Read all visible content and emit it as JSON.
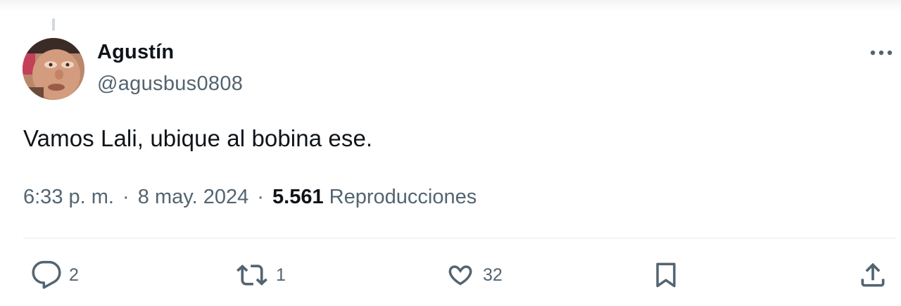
{
  "tweet": {
    "author": {
      "display_name": "Agustín",
      "handle": "@agusbus0808"
    },
    "text": "Vamos Lali, ubique al bobina ese.",
    "time": "6:33 p. m.",
    "date": "8 may. 2024",
    "separator": "·",
    "views_count": "5.561",
    "views_label": "Reproducciones"
  },
  "actions": {
    "reply_count": "2",
    "retweet_count": "1",
    "like_count": "32"
  },
  "icons": {
    "more": "more-horizontal-icon",
    "reply": "comment-bubble-icon",
    "retweet": "retweet-arrows-icon",
    "like": "heart-icon",
    "bookmark": "bookmark-icon",
    "share": "share-upload-icon"
  },
  "colors": {
    "text_primary": "#0f1419",
    "text_secondary": "#536471",
    "divider": "#e6ecf0"
  }
}
